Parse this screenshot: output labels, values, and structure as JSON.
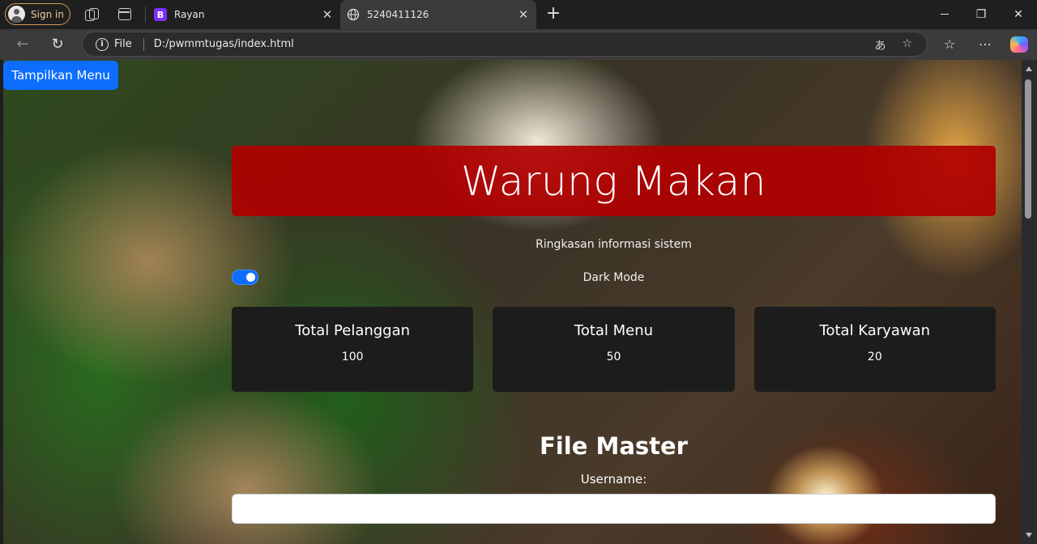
{
  "browser": {
    "signin_label": "Sign in",
    "tabs": [
      {
        "favicon": "bootstrap-icon",
        "favicon_letter": "B",
        "title": "Rayan",
        "active": false
      },
      {
        "favicon": "globe-icon",
        "title": "5240411126",
        "active": true
      }
    ],
    "address": {
      "scheme_label": "File",
      "url": "D:/pwmmtugas/index.html"
    }
  },
  "page": {
    "menu_button": "Tampilkan Menu",
    "hero_title": "Warung Makan",
    "subtitle": "Ringkasan informasi sistem",
    "dark_mode": {
      "label": "Dark Mode",
      "enabled": true
    },
    "stats": [
      {
        "title": "Total Pelanggan",
        "value": "100"
      },
      {
        "title": "Total Menu",
        "value": "50"
      },
      {
        "title": "Total Karyawan",
        "value": "20"
      }
    ],
    "file_master": {
      "title": "File Master",
      "username_label": "Username:",
      "username_value": ""
    }
  },
  "colors": {
    "primary_button": "#0d6efd",
    "hero_banner": "#b00000",
    "card_bg": "#1c1c1c"
  }
}
